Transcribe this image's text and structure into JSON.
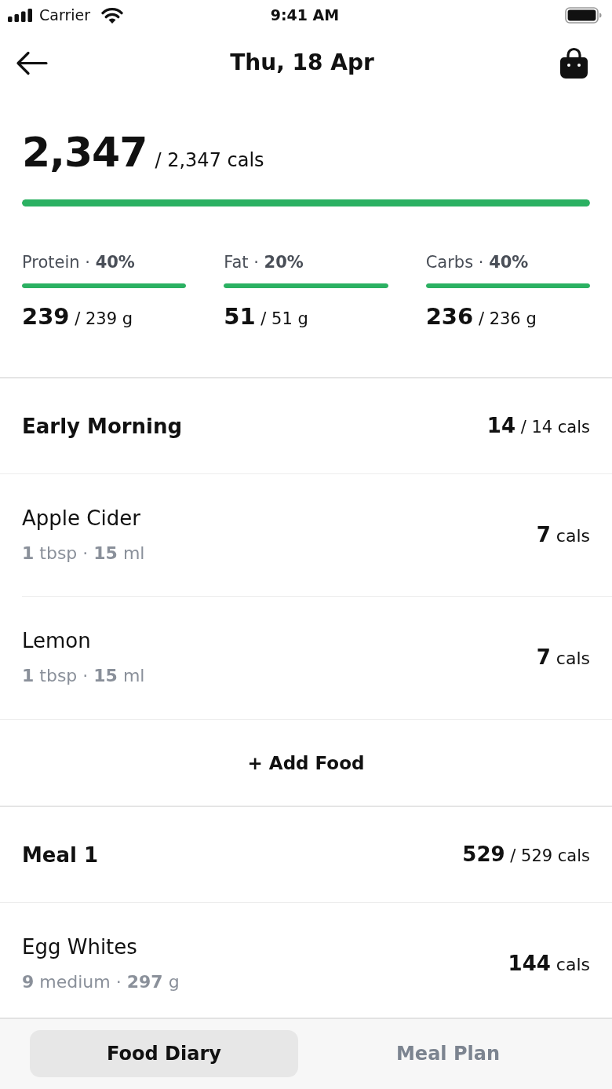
{
  "status_bar": {
    "carrier": "Carrier",
    "time": "9:41 AM"
  },
  "header": {
    "title": "Thu, 18 Apr"
  },
  "summary": {
    "consumed": "2,347",
    "target": "/ 2,347 cals",
    "level": 1
  },
  "macros": [
    {
      "label": "Protein · **40%**",
      "level": 1,
      "amount": "**239** / 239 g"
    },
    {
      "label": "Fat · **20%**",
      "level": 1,
      "amount": "**51** / 51 g"
    },
    {
      "label": "Carbs · **40%**",
      "level": 1,
      "amount": "**236** / 236 g"
    }
  ],
  "meals": [
    {
      "name": "Early Morning",
      "total": "**14** / 14 cals",
      "foods": [
        {
          "name": "Apple Cider",
          "portion": "**1** tbsp · **15** ml",
          "cals": "**7** cals"
        },
        {
          "name": "Lemon",
          "portion": "**1** tbsp · **15** ml",
          "cals": "**7** cals"
        }
      ],
      "add_food": "+ Add Food"
    },
    {
      "name": "Meal 1",
      "total": "**529** / 529 cals",
      "foods": [
        {
          "name": "Egg Whites",
          "portion": "**9** medium · **297** g",
          "cals": "**144** cals"
        }
      ]
    }
  ],
  "tabs": [
    {
      "label": "Food Diary",
      "selected": true
    },
    {
      "label": "Meal Plan",
      "selected": false
    }
  ]
}
